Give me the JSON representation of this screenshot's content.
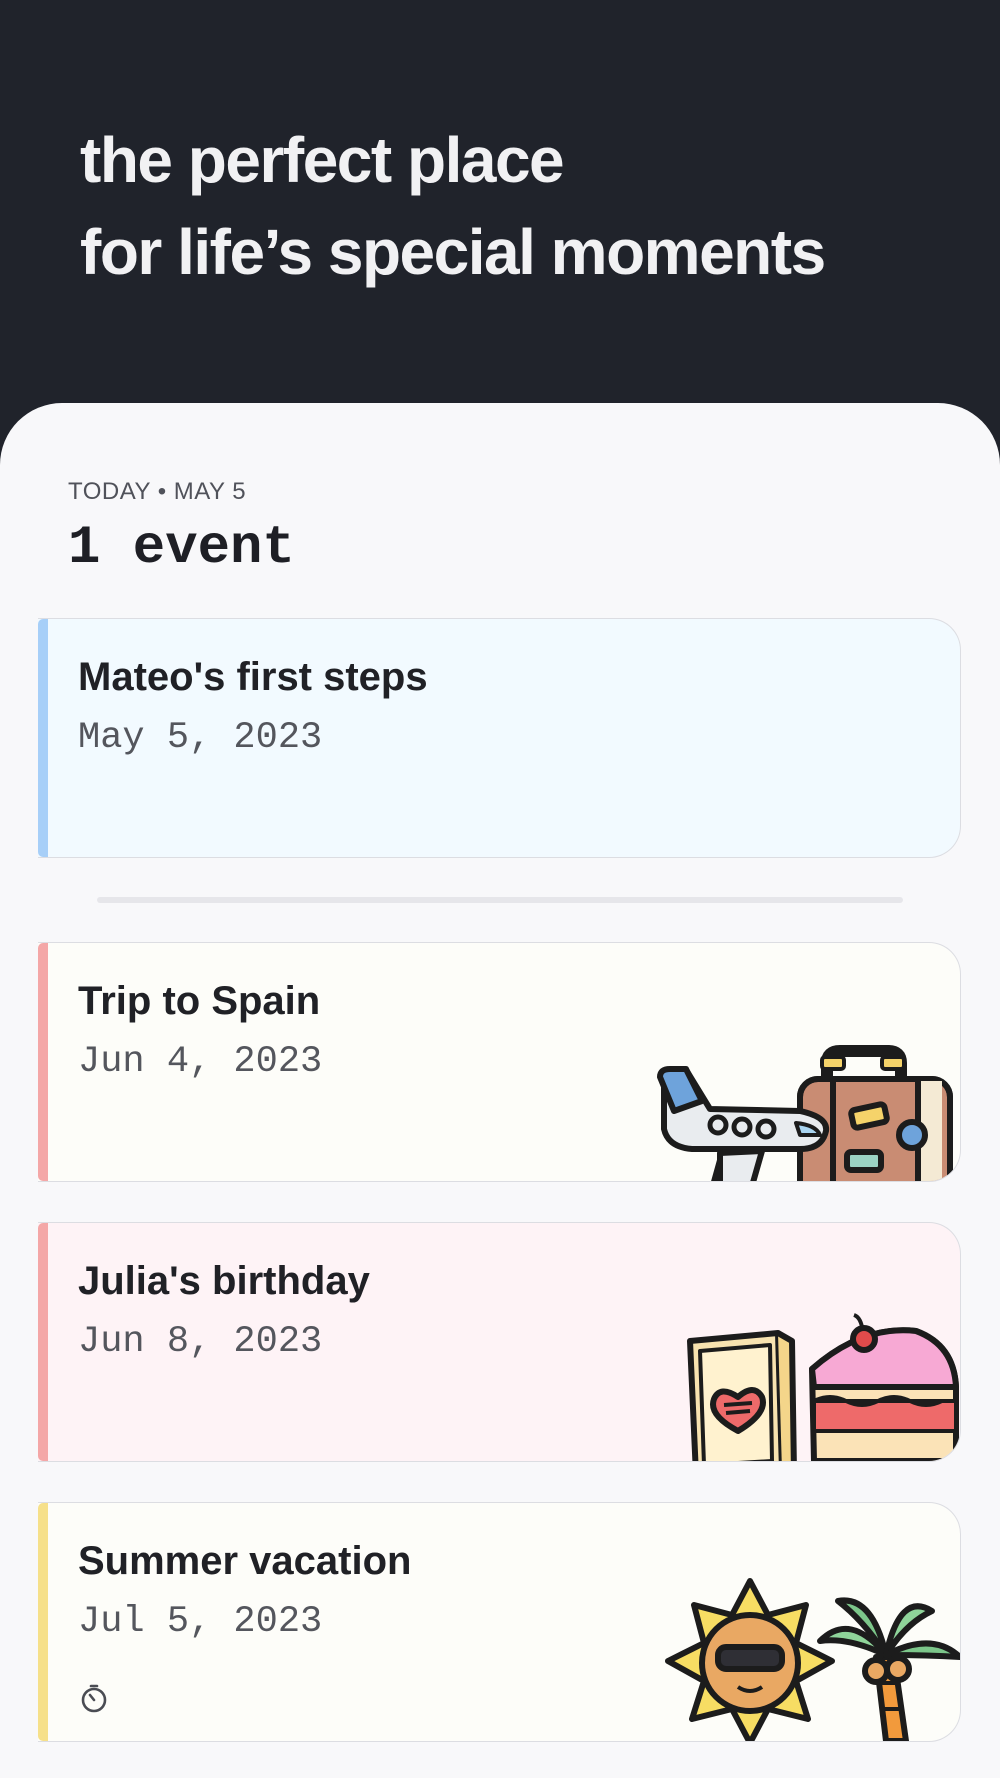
{
  "hero": {
    "line1": "the perfect place",
    "line2": "for life’s special moments"
  },
  "today": {
    "label": "TODAY • MAY 5",
    "count": "1 event"
  },
  "events": [
    {
      "title": "Mateo's first steps",
      "date": "May 5, 2023",
      "accent": "#a7cff8",
      "background": "#f2faff",
      "art": "none"
    },
    {
      "title": "Trip to Spain",
      "date": "Jun 4, 2023",
      "accent": "#f4a7a7",
      "background": "#fdfdf9",
      "art": "airplane-suitcase"
    },
    {
      "title": "Julia's birthday",
      "date": "Jun 8, 2023",
      "accent": "#f4a7a7",
      "background": "#fef3f6",
      "art": "card-cake"
    },
    {
      "title": "Summer vacation",
      "date": "Jul 5, 2023",
      "accent": "#f6e08a",
      "background": "#fdfdf9",
      "art": "sun-palm",
      "icon": "timer-icon"
    }
  ],
  "colors": {
    "hero_bg": "#20232b",
    "sheet_bg": "#f8f8fa",
    "text_dark": "#1e1f25"
  }
}
